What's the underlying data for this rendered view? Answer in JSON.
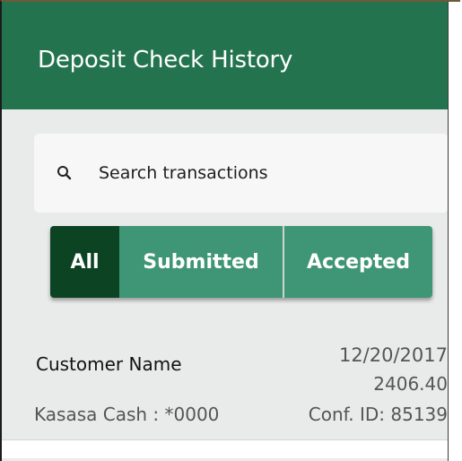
{
  "header": {
    "title": "Deposit Check History"
  },
  "search": {
    "placeholder": "Search transactions",
    "icon": "search-icon"
  },
  "tabs": [
    {
      "label": "All",
      "selected": true
    },
    {
      "label": "Submitted",
      "selected": false
    },
    {
      "label": "Accepted",
      "selected": false
    }
  ],
  "transactions": [
    {
      "customer": "Customer Name",
      "date": "12/20/2017",
      "amount": "2406.40",
      "account": "Kasasa Cash : *0000",
      "confirmation": "Conf. ID: 85139"
    }
  ],
  "colors": {
    "header_bg": "#23744e",
    "tab_selected": "#0c4423",
    "tab_default": "#3f9677",
    "page_bg": "#e9ebea"
  }
}
